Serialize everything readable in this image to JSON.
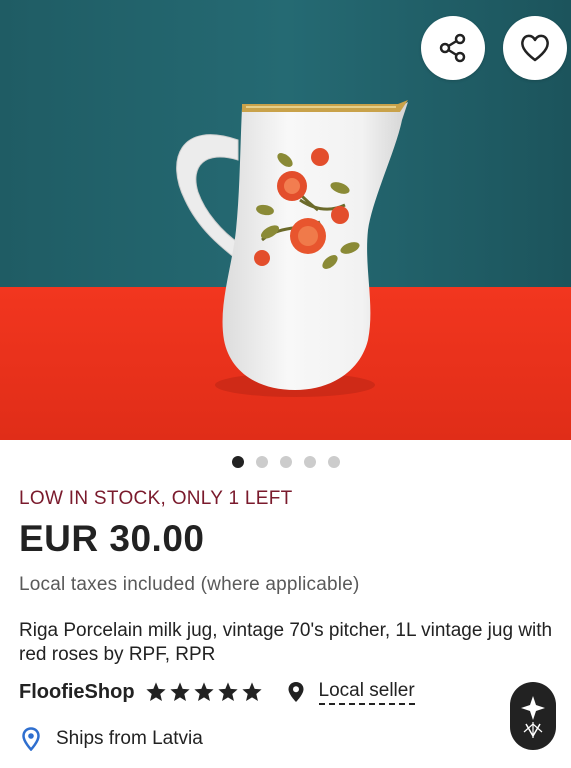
{
  "listing": {
    "image_alt": "White porcelain jug with red roses on teal and red background",
    "carousel": {
      "total": 5,
      "active_index": 0
    },
    "stock_notice": "LOW IN STOCK, ONLY 1 LEFT",
    "price": "EUR 30.00",
    "taxes_note": "Local taxes included (where applicable)",
    "title": "Riga Porcelain milk jug, vintage 70's pitcher, 1L vintage jug with red roses by RPF, RPR",
    "shop": {
      "name": "FloofieShop",
      "rating_stars": 5,
      "local_seller_label": "Local seller"
    },
    "shipping": {
      "ships_from": "Ships from Latvia"
    }
  },
  "actions": {
    "share_icon": "share-icon",
    "favorite_icon": "heart-icon"
  },
  "colors": {
    "stock_notice": "#7a1a2c",
    "location_pin": "#2f6fcf",
    "active_dot": "#222222",
    "inactive_dot": "#cccccc"
  }
}
